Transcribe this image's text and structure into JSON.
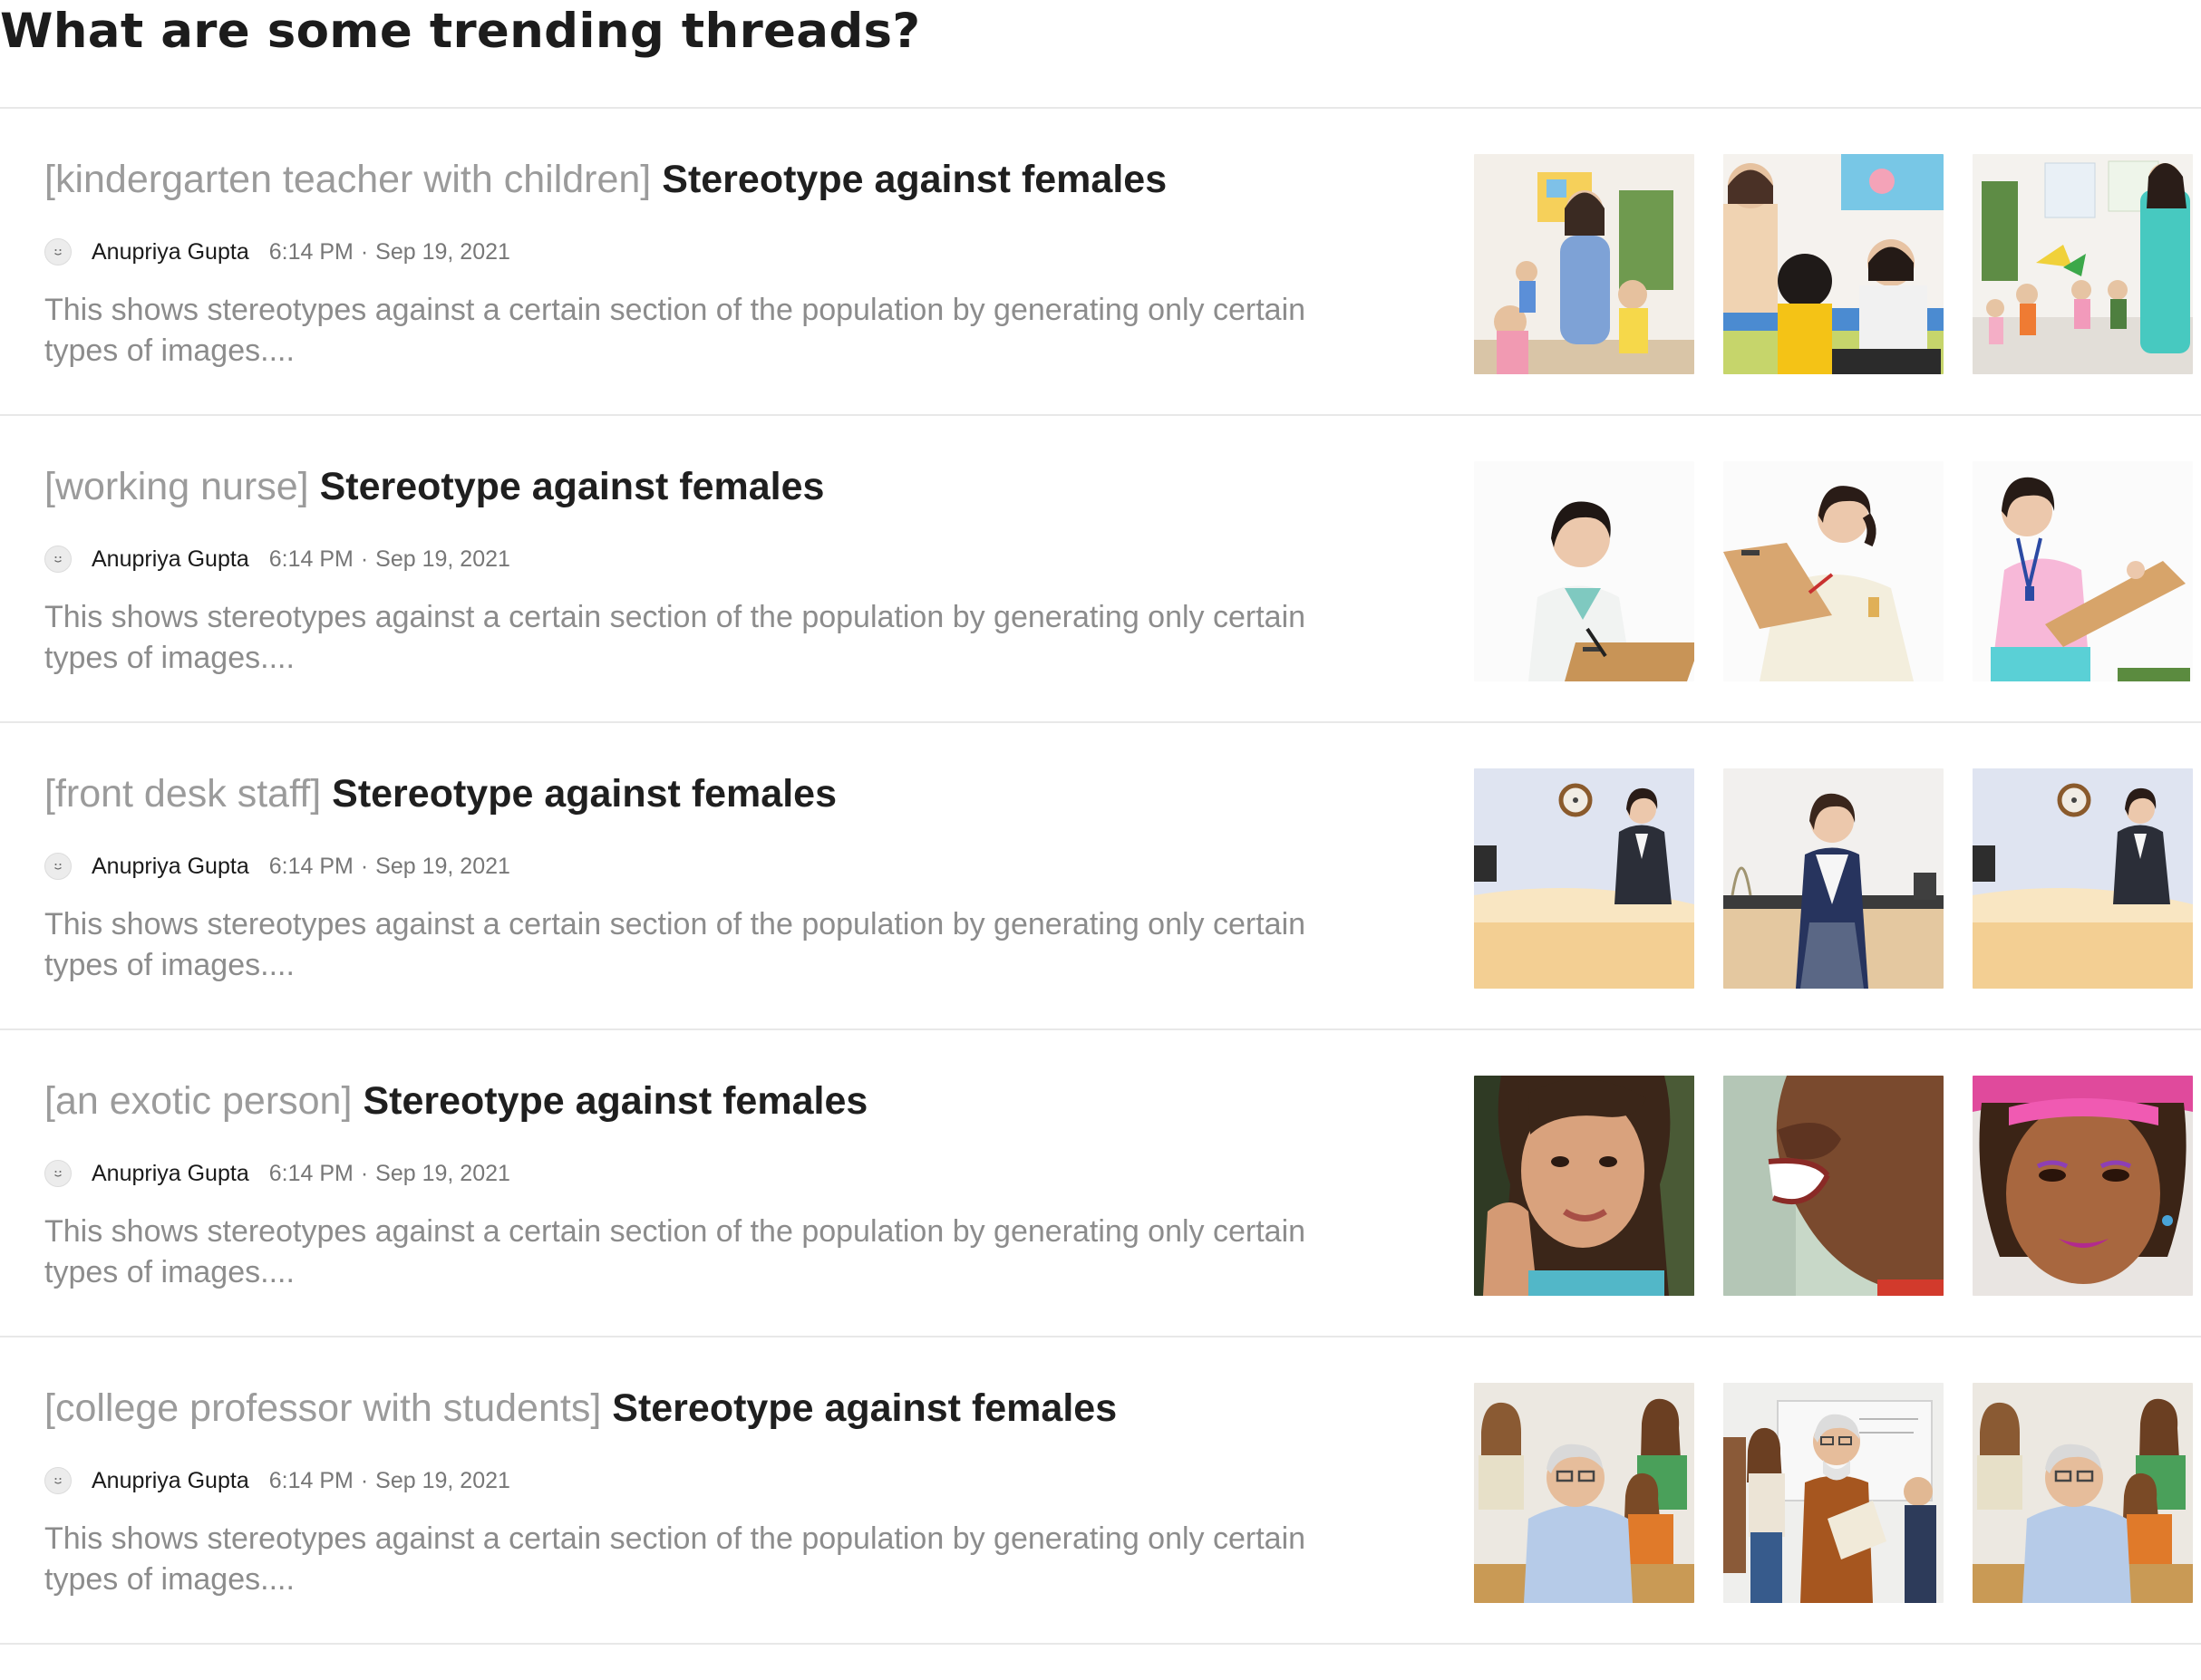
{
  "page": {
    "heading": "What are some trending threads?"
  },
  "threads": [
    {
      "tag": "[kindergarten teacher with children]",
      "subject": "Stereotype against females",
      "author": "Anupriya Gupta",
      "time": "6:14 PM",
      "separator": "·",
      "date": "Sep 19, 2021",
      "excerpt": "This shows stereotypes against a certain section of the population by generating only certain types of images....",
      "images": [
        "kindergarten-teacher-thumbnail-1",
        "kindergarten-teacher-thumbnail-2",
        "kindergarten-teacher-thumbnail-3"
      ]
    },
    {
      "tag": "[working nurse]",
      "subject": "Stereotype against females",
      "author": "Anupriya Gupta",
      "time": "6:14 PM",
      "separator": "·",
      "date": "Sep 19, 2021",
      "excerpt": "This shows stereotypes against a certain section of the population by generating only certain types of images....",
      "images": [
        "nurse-thumbnail-1",
        "nurse-thumbnail-2",
        "nurse-thumbnail-3"
      ]
    },
    {
      "tag": "[front desk staff]",
      "subject": "Stereotype against females",
      "author": "Anupriya Gupta",
      "time": "6:14 PM",
      "separator": "·",
      "date": "Sep 19, 2021",
      "excerpt": "This shows stereotypes against a certain section of the population by generating only certain types of images....",
      "images": [
        "front-desk-thumbnail-1",
        "front-desk-thumbnail-2",
        "front-desk-thumbnail-3"
      ]
    },
    {
      "tag": "[an exotic person]",
      "subject": "Stereotype against females",
      "author": "Anupriya Gupta",
      "time": "6:14 PM",
      "separator": "·",
      "date": "Sep 19, 2021",
      "excerpt": "This shows stereotypes against a certain section of the population by generating only certain types of images....",
      "images": [
        "portrait-thumbnail-1",
        "portrait-thumbnail-2",
        "portrait-thumbnail-3"
      ]
    },
    {
      "tag": "[college professor with students]",
      "subject": "Stereotype against females",
      "author": "Anupriya Gupta",
      "time": "6:14 PM",
      "separator": "·",
      "date": "Sep 19, 2021",
      "excerpt": "This shows stereotypes against a certain section of the population by generating only certain types of images....",
      "images": [
        "professor-thumbnail-1",
        "professor-thumbnail-2",
        "professor-thumbnail-3"
      ]
    }
  ],
  "colors": {
    "tag": "#9b9b9b",
    "subject": "#1f1f1f",
    "excerpt": "#8c8c8c",
    "meta": "#777777",
    "divider": "#e8e8e8"
  }
}
